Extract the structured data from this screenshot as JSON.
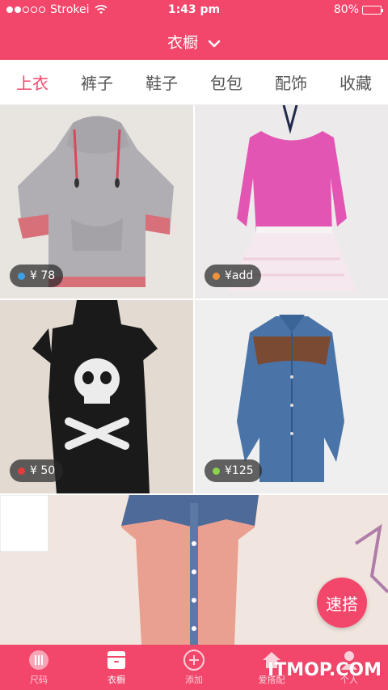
{
  "status_bar": {
    "carrier": "Strokei",
    "time": "1:43 pm",
    "battery": "80%",
    "battery_level": 0.8
  },
  "header": {
    "title": "衣橱"
  },
  "tabs": [
    {
      "label": "上衣",
      "active": true
    },
    {
      "label": "裤子",
      "active": false
    },
    {
      "label": "鞋子",
      "active": false
    },
    {
      "label": "包包",
      "active": false
    },
    {
      "label": "配饰",
      "active": false
    },
    {
      "label": "收藏",
      "active": false
    }
  ],
  "items": [
    {
      "price": "¥ 78",
      "dot_color": "#3aa0e8",
      "description": "grey hoodie with floral trim"
    },
    {
      "price": "¥add",
      "dot_color": "#f0923a",
      "description": "pink long-sleeve top with lace"
    },
    {
      "price": "¥ 50",
      "dot_color": "#e53b3b",
      "description": "black skull tank dress"
    },
    {
      "price": "¥125",
      "dot_color": "#8ad44a",
      "description": "denim shirt"
    },
    {
      "description": "denim and pink chiffon dress"
    }
  ],
  "fab_label": "速搭",
  "bottom_nav": [
    {
      "label": "尺码",
      "icon": "ruler-icon",
      "active": false
    },
    {
      "label": "衣橱",
      "icon": "wardrobe-icon",
      "active": true
    },
    {
      "label": "添加",
      "icon": "add-icon",
      "active": false
    },
    {
      "label": "爱搭配",
      "icon": "home-icon",
      "active": false
    },
    {
      "label": "个人",
      "icon": "person-icon",
      "active": false
    }
  ],
  "watermark": "ITMOP.COM"
}
